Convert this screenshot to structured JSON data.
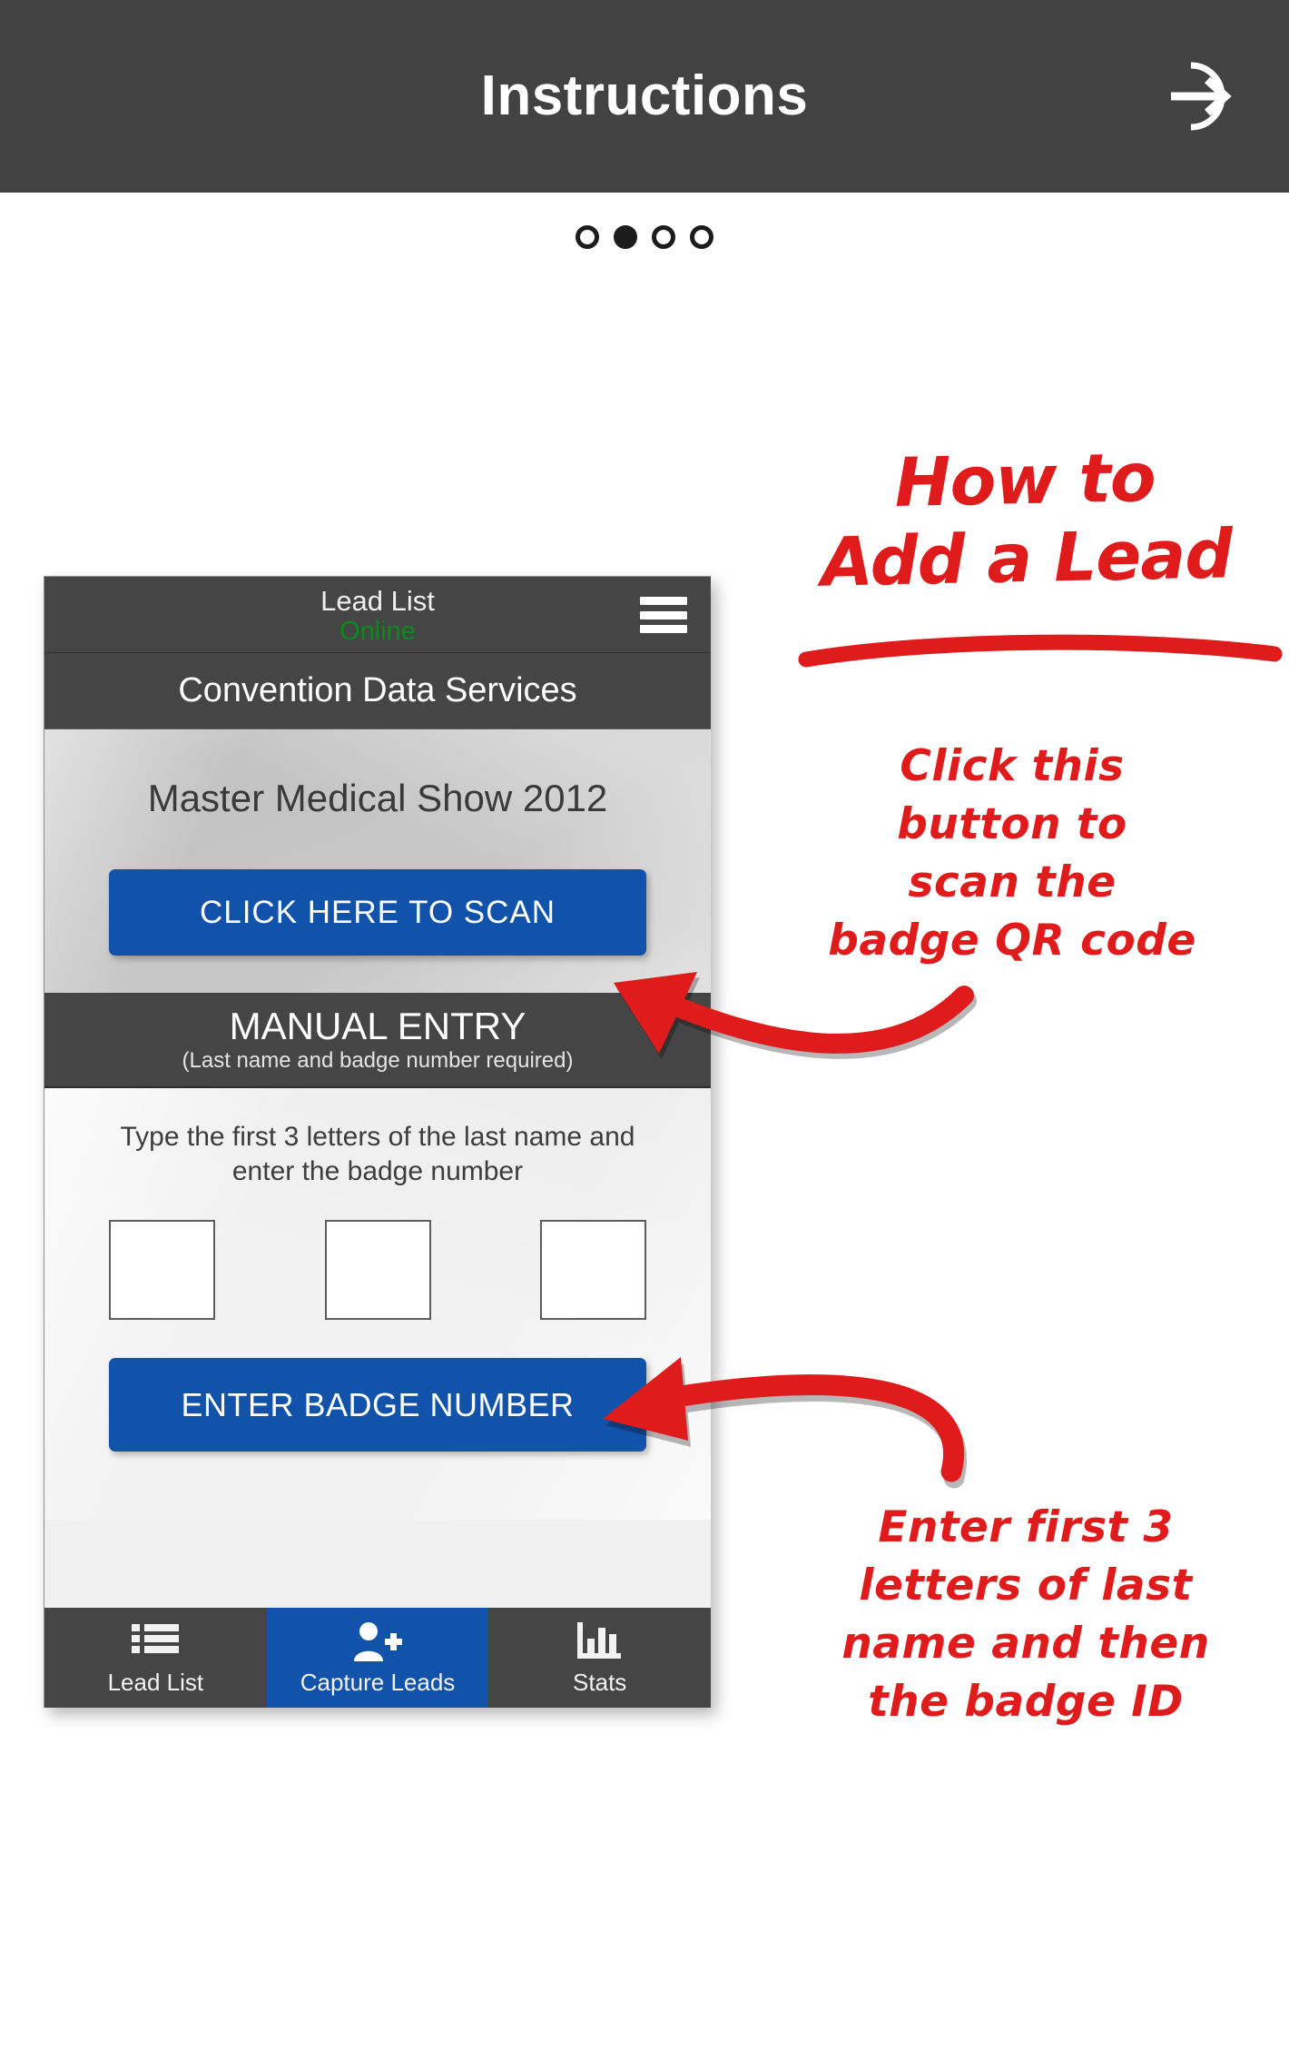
{
  "header": {
    "title": "Instructions",
    "action_icon": "login-arrow-icon"
  },
  "pager": {
    "total": 4,
    "active_index": 1
  },
  "phone": {
    "header": {
      "title": "Lead List",
      "status": "Online",
      "status_color": "#0a8a19",
      "menu_icon": "hamburger-menu-icon"
    },
    "company": "Convention Data Services",
    "scan_section": {
      "show_name": "Master Medical Show 2012",
      "scan_button": "CLICK HERE TO SCAN"
    },
    "manual_entry": {
      "title": "MANUAL ENTRY",
      "subtitle": "(Last name and badge number required)",
      "hint": "Type the first 3 letters of the last name and enter the badge number",
      "fields": [
        {
          "name": "letter-1",
          "value": ""
        },
        {
          "name": "letter-2",
          "value": ""
        },
        {
          "name": "badge-number",
          "value": ""
        }
      ],
      "submit_button": "ENTER BADGE NUMBER"
    },
    "tabs": [
      {
        "label": "Lead List",
        "icon": "list-icon",
        "active": false
      },
      {
        "label": "Capture Leads",
        "icon": "person-add-icon",
        "active": true
      },
      {
        "label": "Stats",
        "icon": "bar-chart-icon",
        "active": false
      }
    ]
  },
  "annotations": {
    "color": "#e01b1b",
    "title": "How to\nAdd a Lead",
    "note_scan": "Click this\nbutton to\nscan the\nbadge QR code",
    "note_manual": "Enter first 3\nletters of last\nname and then\nthe badge ID"
  },
  "colors": {
    "appbar_bg": "#424242",
    "phone_chrome": "#454545",
    "accent_blue": "#1152ab",
    "annotation_red": "#e01b1b",
    "online_green": "#0a8a19"
  }
}
